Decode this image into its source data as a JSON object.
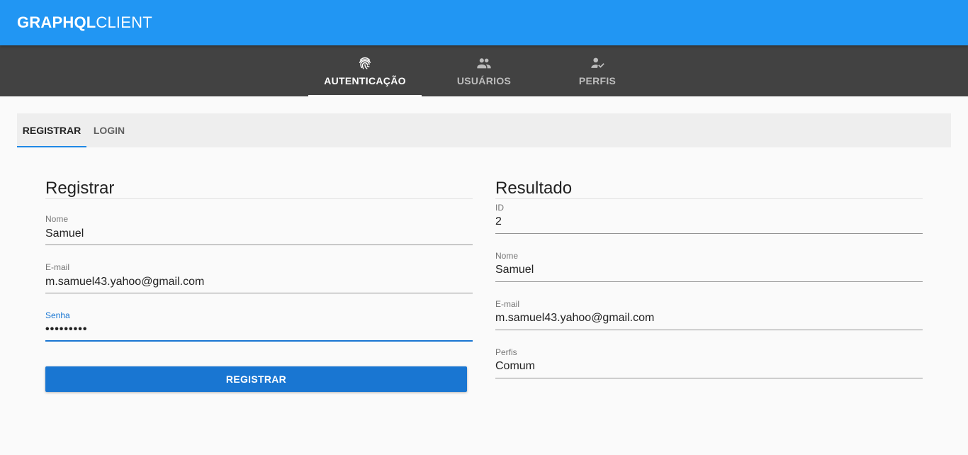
{
  "app": {
    "title_bold": "GRAPHQL",
    "title_light": "CLIENT"
  },
  "main_tabs": [
    {
      "label": "AUTENTICAÇÃO",
      "icon": "fingerprint-icon",
      "active": true
    },
    {
      "label": "USUÁRIOS",
      "icon": "people-icon",
      "active": false
    },
    {
      "label": "PERFIS",
      "icon": "person-check-icon",
      "active": false
    }
  ],
  "sub_tabs": [
    {
      "label": "REGISTRAR",
      "active": true
    },
    {
      "label": "LOGIN",
      "active": false
    }
  ],
  "register_form": {
    "title": "Registrar",
    "name_label": "Nome",
    "name_value": "Samuel",
    "email_label": "E-mail",
    "email_value": "m.samuel43.yahoo@gmail.com",
    "password_label": "Senha",
    "password_value": "•••••••••",
    "submit_label": "REGISTRAR"
  },
  "result": {
    "title": "Resultado",
    "id_label": "ID",
    "id_value": "2",
    "name_label": "Nome",
    "name_value": "Samuel",
    "email_label": "E-mail",
    "email_value": "m.samuel43.yahoo@gmail.com",
    "profiles_label": "Perfis",
    "profiles_value": "Comum"
  },
  "colors": {
    "appbar": "#2196f3",
    "navbar": "#424242",
    "primary_button": "#1976d2",
    "focus": "#1976d2",
    "subtab_indicator": "#1e88e5"
  }
}
